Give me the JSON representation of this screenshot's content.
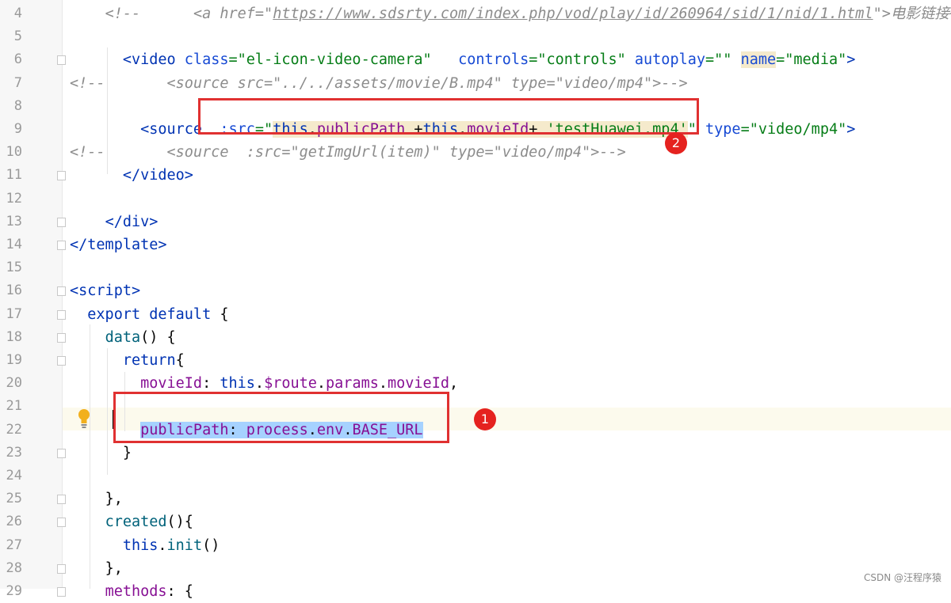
{
  "editor": {
    "lines": [
      {
        "num": "4",
        "indent": "    ",
        "parts": [
          {
            "t": "<!--",
            "c": "cmt"
          },
          {
            "t": "      <a href=\"",
            "c": "cmt"
          },
          {
            "t": "https://www.sdsrty.com/index.php/vod/play/id/260964/sid/1/nid/1.html",
            "c": "cmt ul"
          },
          {
            "t": "\">电影链接+{{th",
            "c": "cmt"
          }
        ]
      },
      {
        "num": "5",
        "indent": "",
        "parts": []
      },
      {
        "num": "6",
        "indent": "      ",
        "parts": [
          {
            "t": "<video ",
            "c": "tag"
          },
          {
            "t": "class",
            "c": "attr"
          },
          {
            "t": "=\"el-icon-video-camera\"",
            "c": "str"
          },
          {
            "t": "   controls",
            "c": "attr"
          },
          {
            "t": "=\"controls\"",
            "c": "str"
          },
          {
            "t": " autoplay",
            "c": "attr"
          },
          {
            "t": "=\"\"",
            "c": "str"
          },
          {
            "t": " ",
            "c": "plain"
          },
          {
            "t": "name",
            "c": "attr hl-bg"
          },
          {
            "t": "=\"media\"",
            "c": "str"
          },
          {
            "t": ">",
            "c": "tag"
          }
        ]
      },
      {
        "num": "7",
        "indent": "",
        "parts": [
          {
            "t": "<!--",
            "c": "cmt"
          },
          {
            "t": "       <source src=\"../../assets/movie/B.mp4\" type=\"video/mp4\">-->",
            "c": "cmt"
          }
        ]
      },
      {
        "num": "8",
        "indent": "",
        "parts": []
      },
      {
        "num": "9",
        "indent": "        ",
        "parts": [
          {
            "t": "<source",
            "c": "tag"
          },
          {
            "t": "  :src",
            "c": "attr"
          },
          {
            "t": "=\"",
            "c": "str"
          },
          {
            "t": "this",
            "c": "kw hl-bg"
          },
          {
            "t": ".",
            "c": "plain hl-bg"
          },
          {
            "t": "publicPath",
            "c": "prop hl-bg"
          },
          {
            "t": " +",
            "c": "plain hl-bg"
          },
          {
            "t": "this",
            "c": "kw hl-bg"
          },
          {
            "t": ".",
            "c": "plain hl-bg"
          },
          {
            "t": "movieId",
            "c": "prop hl-bg"
          },
          {
            "t": "+ ",
            "c": "plain hl-bg"
          },
          {
            "t": "'testHuawei.mp4'",
            "c": "str hl-bg"
          },
          {
            "t": "\"",
            "c": "str"
          },
          {
            "t": " type",
            "c": "attr"
          },
          {
            "t": "=\"video/mp4\"",
            "c": "str"
          },
          {
            "t": ">",
            "c": "tag"
          }
        ]
      },
      {
        "num": "10",
        "indent": "",
        "parts": [
          {
            "t": "<!--",
            "c": "cmt"
          },
          {
            "t": "       <source  :src=\"getImgUrl(item)\" type=\"video/mp4\">-->",
            "c": "cmt"
          }
        ]
      },
      {
        "num": "11",
        "indent": "      ",
        "parts": [
          {
            "t": "</video>",
            "c": "tag"
          }
        ]
      },
      {
        "num": "12",
        "indent": "",
        "parts": []
      },
      {
        "num": "13",
        "indent": "    ",
        "parts": [
          {
            "t": "</div>",
            "c": "tag"
          }
        ]
      },
      {
        "num": "14",
        "indent": "",
        "parts": [
          {
            "t": "</template>",
            "c": "tag"
          }
        ]
      },
      {
        "num": "15",
        "indent": "",
        "parts": []
      },
      {
        "num": "16",
        "indent": "",
        "parts": [
          {
            "t": "<script>",
            "c": "tag"
          }
        ]
      },
      {
        "num": "17",
        "indent": "  ",
        "parts": [
          {
            "t": "export default",
            "c": "kw"
          },
          {
            "t": " {",
            "c": "plain"
          }
        ]
      },
      {
        "num": "18",
        "indent": "    ",
        "parts": [
          {
            "t": "data",
            "c": "fn"
          },
          {
            "t": "() {",
            "c": "plain"
          }
        ]
      },
      {
        "num": "19",
        "indent": "      ",
        "parts": [
          {
            "t": "return",
            "c": "kw"
          },
          {
            "t": "{",
            "c": "plain"
          }
        ]
      },
      {
        "num": "20",
        "indent": "        ",
        "parts": [
          {
            "t": "movieId",
            "c": "prop"
          },
          {
            "t": ": ",
            "c": "plain"
          },
          {
            "t": "this",
            "c": "kw"
          },
          {
            "t": ".",
            "c": "plain"
          },
          {
            "t": "$route",
            "c": "prop"
          },
          {
            "t": ".",
            "c": "plain"
          },
          {
            "t": "params",
            "c": "prop"
          },
          {
            "t": ".",
            "c": "plain"
          },
          {
            "t": "movieId",
            "c": "prop"
          },
          {
            "t": ",",
            "c": "plain"
          }
        ]
      },
      {
        "num": "21",
        "indent": "",
        "parts": []
      },
      {
        "num": "22",
        "indent": "        ",
        "parts": [
          {
            "t": "publicPath",
            "c": "prop sel-bg"
          },
          {
            "t": ": ",
            "c": "plain sel-bg"
          },
          {
            "t": "process",
            "c": "prop sel-bg"
          },
          {
            "t": ".",
            "c": "plain sel-bg"
          },
          {
            "t": "env",
            "c": "prop sel-bg"
          },
          {
            "t": ".",
            "c": "plain sel-bg"
          },
          {
            "t": "BASE_URL",
            "c": "prop sel-bg"
          }
        ]
      },
      {
        "num": "23",
        "indent": "      ",
        "parts": [
          {
            "t": "}",
            "c": "plain"
          }
        ]
      },
      {
        "num": "24",
        "indent": "",
        "parts": []
      },
      {
        "num": "25",
        "indent": "    ",
        "parts": [
          {
            "t": "},",
            "c": "plain"
          }
        ]
      },
      {
        "num": "26",
        "indent": "    ",
        "parts": [
          {
            "t": "created",
            "c": "fn"
          },
          {
            "t": "(){",
            "c": "plain"
          }
        ]
      },
      {
        "num": "27",
        "indent": "      ",
        "parts": [
          {
            "t": "this",
            "c": "kw"
          },
          {
            "t": ".",
            "c": "plain"
          },
          {
            "t": "init",
            "c": "fn"
          },
          {
            "t": "()",
            "c": "plain"
          }
        ]
      },
      {
        "num": "28",
        "indent": "    ",
        "parts": [
          {
            "t": "},",
            "c": "plain"
          }
        ]
      },
      {
        "num": "29",
        "indent": "    ",
        "parts": [
          {
            "t": "methods",
            "c": "prop"
          },
          {
            "t": ": {",
            "c": "plain"
          }
        ]
      }
    ]
  },
  "annotations": {
    "badge_1": "1",
    "badge_2": "2"
  },
  "watermark": "CSDN @汪程序猿",
  "icons": {
    "gutter_bulb": "lightbulb-icon",
    "fold_marker": "fold-marker-icon"
  }
}
